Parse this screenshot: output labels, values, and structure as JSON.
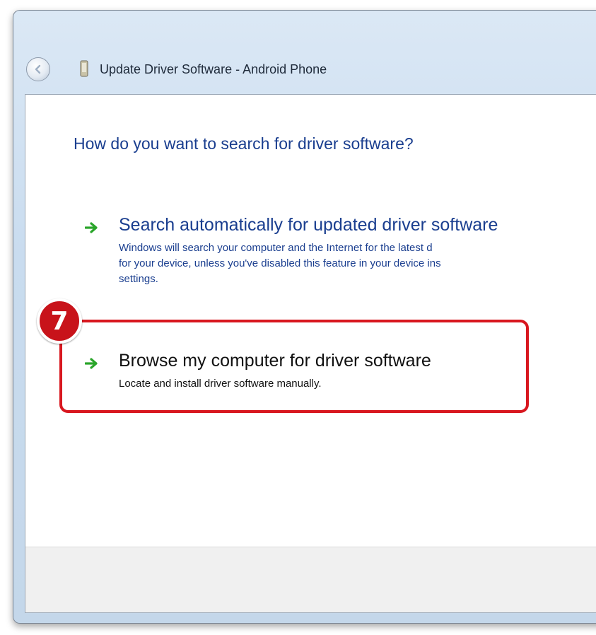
{
  "window": {
    "title": "Update Driver Software - Android Phone",
    "back_icon": "back-arrow-icon",
    "device_icon": "phone-icon"
  },
  "dialog": {
    "heading": "How do you want to search for driver software?",
    "options": [
      {
        "title": "Search automatically for updated driver software",
        "description": "Windows will search your computer and the Internet for the latest d\nfor your device, unless you've disabled this feature in your device ins\nsettings.",
        "icon": "green-arrow-icon"
      },
      {
        "title": "Browse my computer for driver software",
        "description": "Locate and install driver software manually.",
        "icon": "green-arrow-icon"
      }
    ]
  },
  "annotation": {
    "step_number": "7",
    "color": "#d8171f"
  },
  "colors": {
    "heading": "#1a3e8f",
    "arrow": "#2aa52a"
  }
}
